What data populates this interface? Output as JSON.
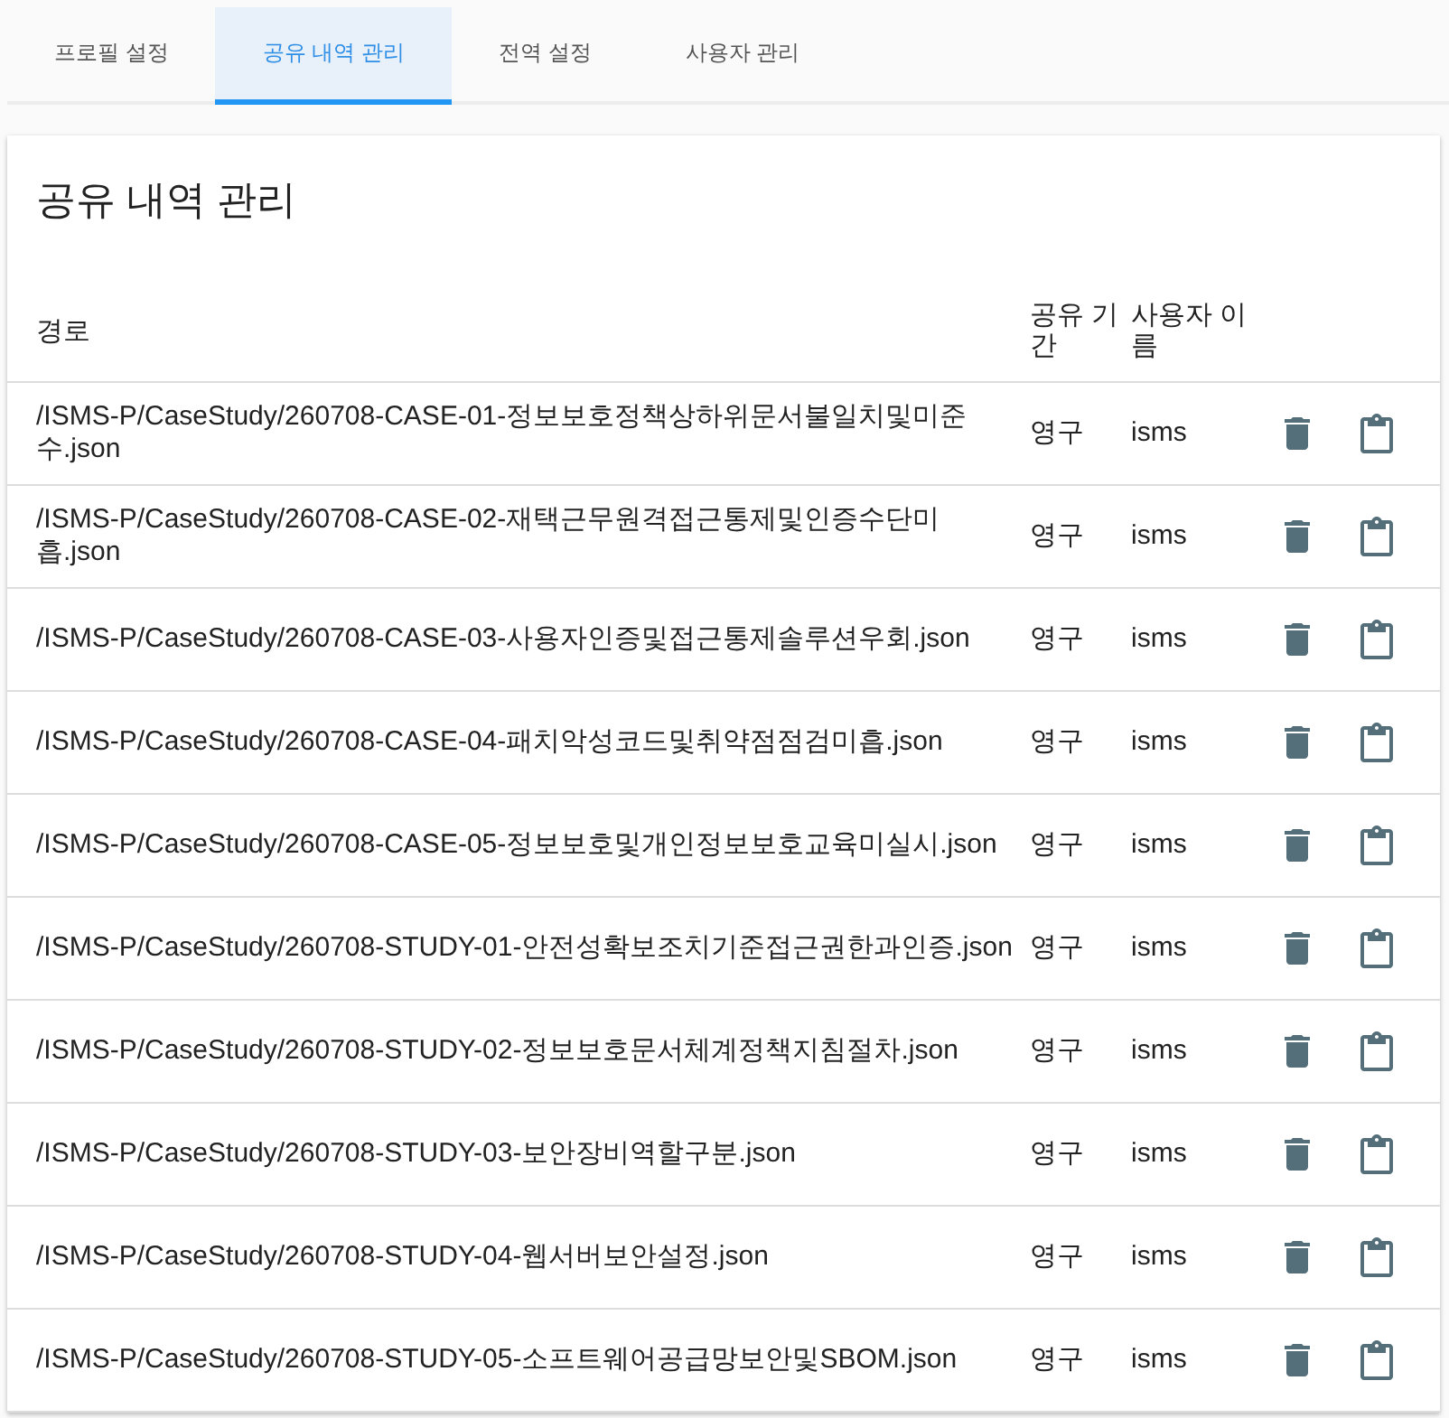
{
  "tabs": [
    {
      "label": "프로필 설정",
      "selected": false
    },
    {
      "label": "공유 내역 관리",
      "selected": true
    },
    {
      "label": "전역 설정",
      "selected": false
    },
    {
      "label": "사용자 관리",
      "selected": false
    }
  ],
  "panel": {
    "title": "공유 내역 관리"
  },
  "table": {
    "columns": [
      "경로",
      "공유 기간",
      "사용자 이름"
    ],
    "rows": [
      {
        "path": "/ISMS-P/CaseStudy/260708-CASE-01-정보보호정책상하위문서불일치및미준수.json",
        "period": "영구",
        "user": "isms"
      },
      {
        "path": "/ISMS-P/CaseStudy/260708-CASE-02-재택근무원격접근통제및인증수단미흡.json",
        "period": "영구",
        "user": "isms"
      },
      {
        "path": "/ISMS-P/CaseStudy/260708-CASE-03-사용자인증및접근통제솔루션우회.json",
        "period": "영구",
        "user": "isms"
      },
      {
        "path": "/ISMS-P/CaseStudy/260708-CASE-04-패치악성코드및취약점점검미흡.json",
        "period": "영구",
        "user": "isms"
      },
      {
        "path": "/ISMS-P/CaseStudy/260708-CASE-05-정보보호및개인정보보호교육미실시.json",
        "period": "영구",
        "user": "isms"
      },
      {
        "path": "/ISMS-P/CaseStudy/260708-STUDY-01-안전성확보조치기준접근권한과인증.json",
        "period": "영구",
        "user": "isms"
      },
      {
        "path": "/ISMS-P/CaseStudy/260708-STUDY-02-정보보호문서체계정책지침절차.json",
        "period": "영구",
        "user": "isms"
      },
      {
        "path": "/ISMS-P/CaseStudy/260708-STUDY-03-보안장비역할구분.json",
        "period": "영구",
        "user": "isms"
      },
      {
        "path": "/ISMS-P/CaseStudy/260708-STUDY-04-웹서버보안설정.json",
        "period": "영구",
        "user": "isms"
      },
      {
        "path": "/ISMS-P/CaseStudy/260708-STUDY-05-소프트웨어공급망보안및SBOM.json",
        "period": "영구",
        "user": "isms"
      }
    ]
  }
}
